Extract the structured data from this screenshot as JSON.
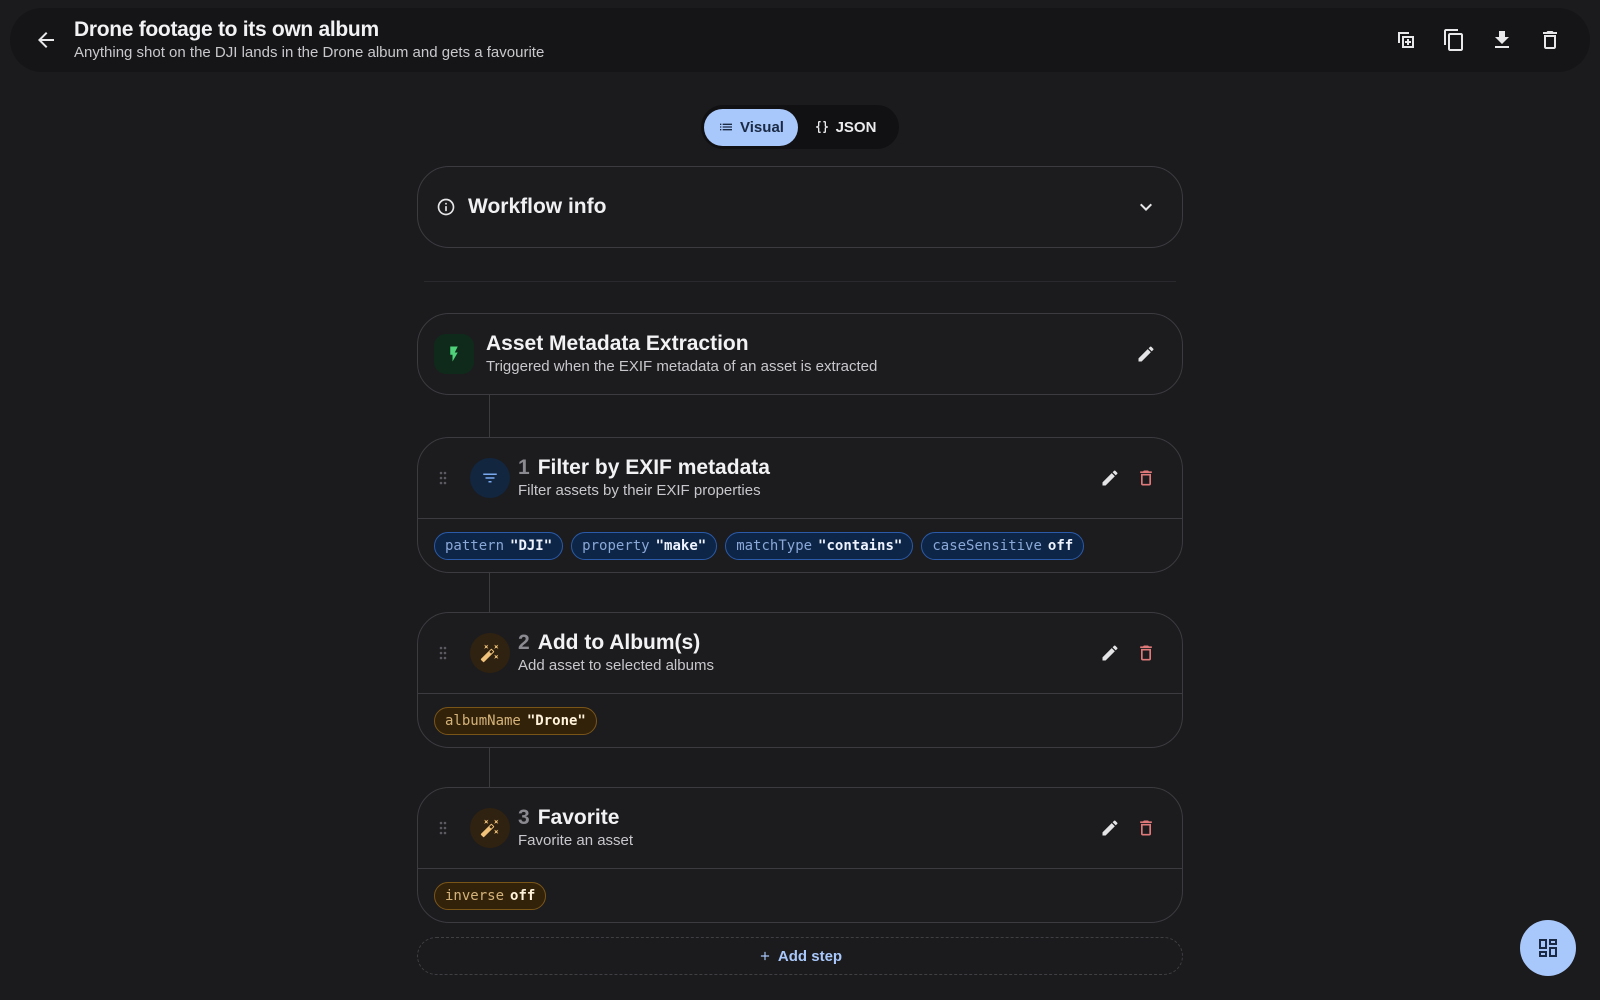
{
  "header": {
    "title": "Drone footage to its own album",
    "subtitle": "Anything shot on the DJI lands in the Drone album and gets a favourite",
    "actions": [
      "duplicate-icon",
      "copy-icon",
      "download-icon",
      "trash-icon"
    ]
  },
  "view_toggle": {
    "visual_label": "Visual",
    "json_label": "JSON",
    "selected": "Visual"
  },
  "workflow_info": {
    "title": "Workflow info"
  },
  "trigger": {
    "title": "Asset Metadata Extraction",
    "subtitle": "Triggered when the EXIF metadata of an asset is extracted"
  },
  "steps": [
    {
      "number": "1",
      "title": "Filter by EXIF metadata",
      "subtitle": "Filter assets by their EXIF properties",
      "kind": "filter",
      "params": [
        {
          "key": "pattern",
          "value": "\"DJI\""
        },
        {
          "key": "property",
          "value": "\"make\""
        },
        {
          "key": "matchType",
          "value": "\"contains\""
        },
        {
          "key": "caseSensitive",
          "value": "off"
        }
      ]
    },
    {
      "number": "2",
      "title": "Add to Album(s)",
      "subtitle": "Add asset to selected albums",
      "kind": "action",
      "params": [
        {
          "key": "albumName",
          "value": "\"Drone\""
        }
      ]
    },
    {
      "number": "3",
      "title": "Favorite",
      "subtitle": "Favorite an asset",
      "kind": "action",
      "params": [
        {
          "key": "inverse",
          "value": "off"
        }
      ]
    }
  ],
  "add_step_label": "Add step",
  "colors": {
    "background": "#1b1b1d",
    "accent": "#a8c7fa",
    "filter_chip": "#0d2547",
    "action_chip": "#33220a",
    "delete": "#e07a7a"
  }
}
